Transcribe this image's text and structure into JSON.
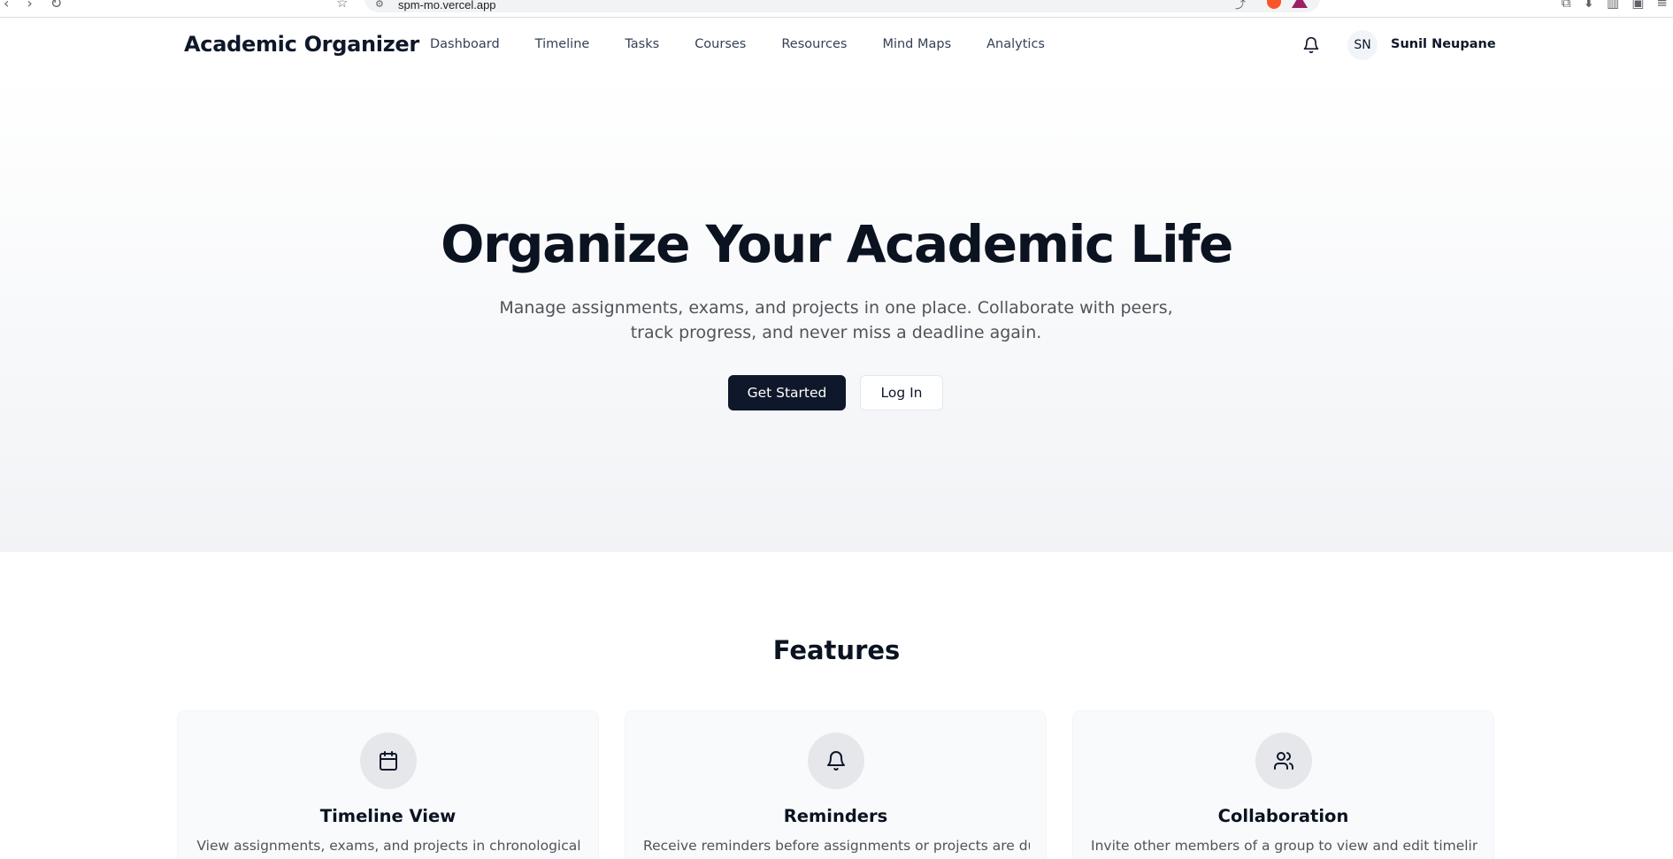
{
  "browser": {
    "url": "spm-mo.vercel.app"
  },
  "header": {
    "brand": "Academic Organizer",
    "nav": [
      "Dashboard",
      "Timeline",
      "Tasks",
      "Courses",
      "Resources",
      "Mind Maps",
      "Analytics"
    ],
    "notification_icon": "bell-icon",
    "user": {
      "initials": "SN",
      "name": "Sunil Neupane"
    }
  },
  "hero": {
    "title": "Organize Your Academic Life",
    "subtitle": "Manage assignments, exams, and projects in one place. Collaborate with peers, track progress, and never miss a deadline again.",
    "primary_button": "Get Started",
    "secondary_button": "Log In"
  },
  "features": {
    "title": "Features",
    "cards": [
      {
        "icon": "calendar-icon",
        "title": "Timeline View",
        "description": "View assignments, exams, and projects in chronological"
      },
      {
        "icon": "bell-icon",
        "title": "Reminders",
        "description": "Receive reminders before assignments or projects are due"
      },
      {
        "icon": "users-icon",
        "title": "Collaboration",
        "description": "Invite other members of a group to view and edit timelines,"
      }
    ]
  },
  "colors": {
    "primary": "#0f172a",
    "muted_text": "#52525b",
    "card_bg": "#f8fafc",
    "icon_circle": "#e5e7eb"
  }
}
